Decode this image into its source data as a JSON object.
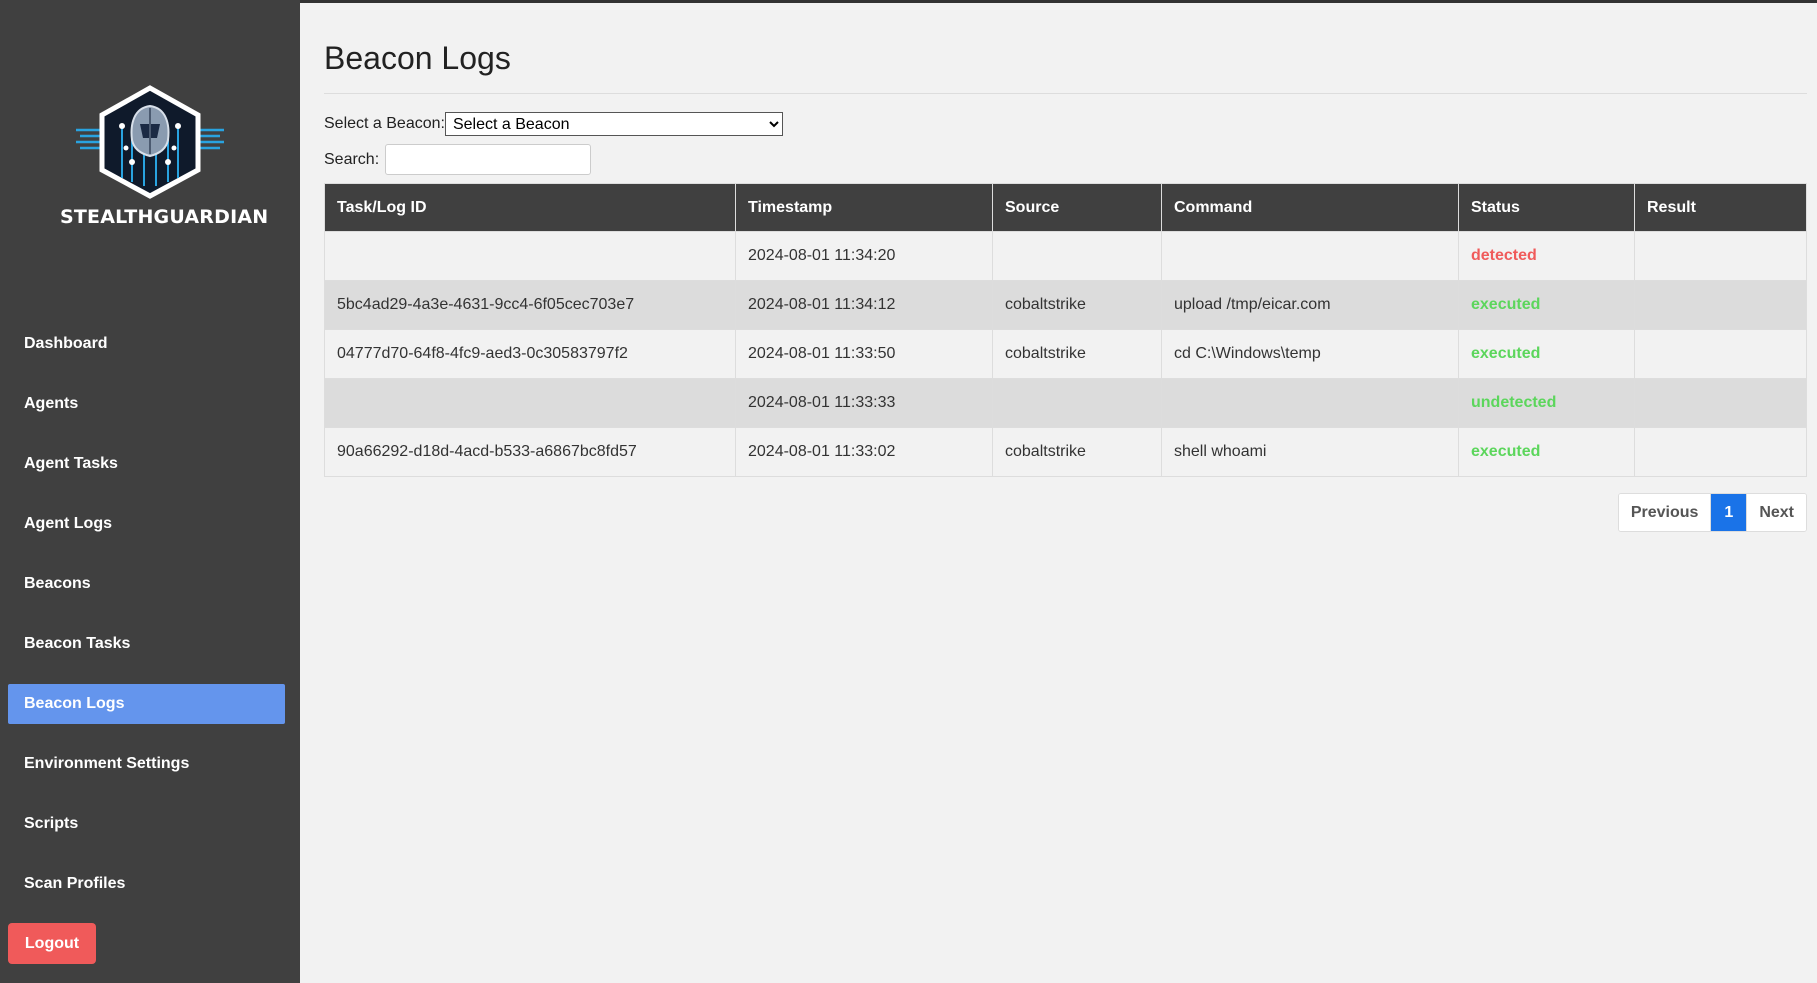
{
  "app": {
    "brand": "STEALTHGUARDIAN"
  },
  "colors": {
    "sidebar_bg": "#404040",
    "active_nav": "#6495ed",
    "logout": "#f05a5a",
    "detected": "#f05a5a",
    "executed": "#5cd65c",
    "page_current": "#1a73e8"
  },
  "sidebar": {
    "items": [
      {
        "label": "Dashboard",
        "active": false
      },
      {
        "label": "Agents",
        "active": false
      },
      {
        "label": "Agent Tasks",
        "active": false
      },
      {
        "label": "Agent Logs",
        "active": false
      },
      {
        "label": "Beacons",
        "active": false
      },
      {
        "label": "Beacon Tasks",
        "active": false
      },
      {
        "label": "Beacon Logs",
        "active": true
      },
      {
        "label": "Environment Settings",
        "active": false
      },
      {
        "label": "Scripts",
        "active": false
      },
      {
        "label": "Scan Profiles",
        "active": false
      }
    ],
    "logout_label": "Logout"
  },
  "main": {
    "title": "Beacon Logs",
    "beacon_select": {
      "label": "Select a Beacon:",
      "selected": "Select a Beacon"
    },
    "search": {
      "label": "Search:",
      "value": ""
    },
    "table": {
      "columns": [
        "Task/Log ID",
        "Timestamp",
        "Source",
        "Command",
        "Status",
        "Result"
      ],
      "rows": [
        {
          "id": "",
          "timestamp": "2024-08-01 11:34:20",
          "source": "",
          "command": "",
          "status": "detected",
          "result": ""
        },
        {
          "id": "5bc4ad29-4a3e-4631-9cc4-6f05cec703e7",
          "timestamp": "2024-08-01 11:34:12",
          "source": "cobaltstrike",
          "command": "upload /tmp/eicar.com",
          "status": "executed",
          "result": ""
        },
        {
          "id": "04777d70-64f8-4fc9-aed3-0c30583797f2",
          "timestamp": "2024-08-01 11:33:50",
          "source": "cobaltstrike",
          "command": "cd C:\\Windows\\temp",
          "status": "executed",
          "result": ""
        },
        {
          "id": "",
          "timestamp": "2024-08-01 11:33:33",
          "source": "",
          "command": "",
          "status": "undetected",
          "result": ""
        },
        {
          "id": "90a66292-d18d-4acd-b533-a6867bc8fd57",
          "timestamp": "2024-08-01 11:33:02",
          "source": "cobaltstrike",
          "command": "shell whoami",
          "status": "executed",
          "result": ""
        }
      ]
    },
    "pagination": {
      "previous": "Previous",
      "current": "1",
      "next": "Next"
    }
  }
}
